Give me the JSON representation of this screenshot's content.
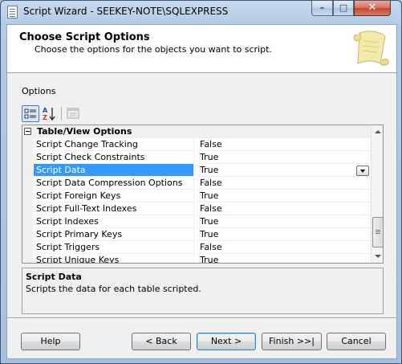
{
  "window": {
    "title": "Script Wizard - SEEKEY-NOTE\\SQLEXPRESS",
    "minimize": "–",
    "maximize": "□",
    "close": "✕"
  },
  "header": {
    "title": "Choose Script Options",
    "subtitle": "Choose the options for the objects you want to script."
  },
  "options_label": "Options",
  "grid": {
    "category": "Table/View Options",
    "rows": [
      {
        "name": "Script Change Tracking",
        "value": "False"
      },
      {
        "name": "Script Check Constraints",
        "value": "True"
      },
      {
        "name": "Script Data",
        "value": "True",
        "selected": true
      },
      {
        "name": "Script Data Compression Options",
        "value": "False"
      },
      {
        "name": "Script Foreign Keys",
        "value": "True"
      },
      {
        "name": "Script Full-Text Indexes",
        "value": "False"
      },
      {
        "name": "Script Indexes",
        "value": "True"
      },
      {
        "name": "Script Primary Keys",
        "value": "True"
      },
      {
        "name": "Script Triggers",
        "value": "False"
      },
      {
        "name": "Script Unique Keys",
        "value": "True"
      }
    ]
  },
  "description": {
    "title": "Script Data",
    "text": "Scripts the data for each table scripted."
  },
  "buttons": {
    "help": "Help",
    "back": "< Back",
    "next": "Next >",
    "finish": "Finish >>|",
    "cancel": "Cancel"
  },
  "colors": {
    "selection": "#3399ff",
    "dialog_bg": "#f0f0f0"
  },
  "icons": [
    "categorized-icon",
    "alphabetical-sort-icon",
    "property-pages-icon",
    "scroll-paper-icon"
  ]
}
